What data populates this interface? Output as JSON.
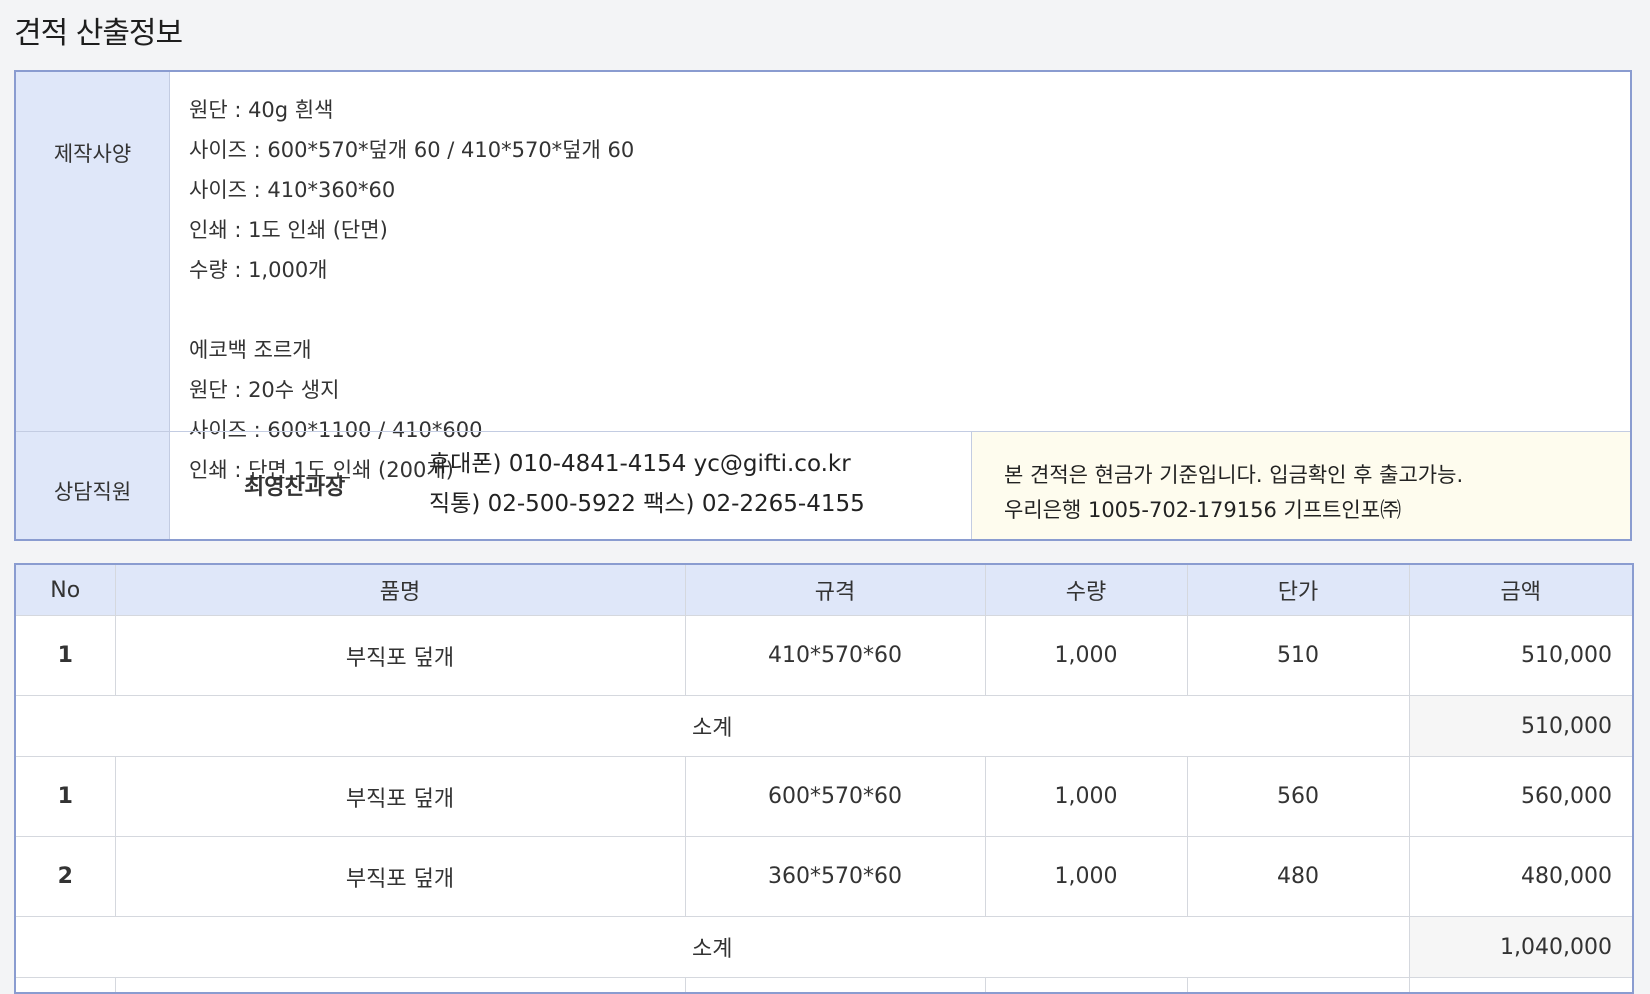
{
  "page": {
    "title": "견적 산출정보"
  },
  "info": {
    "spec_label": "제작사양",
    "spec_lines": [
      "원단 : 40g 흰색",
      "사이즈 : 600*570*덮개 60 / 410*570*덮개 60",
      "사이즈 : 410*360*60",
      "인쇄 : 1도 인쇄 (단면)",
      "수량 : 1,000개",
      "",
      "에코백 조르개",
      "원단 : 20수 생지",
      "사이즈 : 600*1100 / 410*600",
      "인쇄 : 단면 1도 인쇄 (200개)"
    ],
    "staff_label": "상담직원",
    "staff_name": "최영찬과장",
    "phone_line": "휴대폰) 010-4841-4154  yc@gifti.co.kr",
    "direct_line": "직통) 02-500-5922 팩스) 02-2265-4155",
    "notice_line1": "본 견적은 현금가 기준입니다. 입금확인 후 출고가능.",
    "notice_line2": "우리은행 1005-702-179156 기프트인포㈜"
  },
  "table": {
    "headers": [
      "No",
      "품명",
      "규격",
      "수량",
      "단가",
      "금액"
    ],
    "rows": [
      {
        "no": "1",
        "name": "부직포 덮개",
        "spec": "410*570*60",
        "qty": "1,000",
        "unit": "510",
        "amount": "510,000"
      },
      {
        "subtotal_label": "소계",
        "amount": "510,000"
      },
      {
        "no": "1",
        "name": "부직포 덮개",
        "spec": "600*570*60",
        "qty": "1,000",
        "unit": "560",
        "amount": "560,000"
      },
      {
        "no": "2",
        "name": "부직포 덮개",
        "spec": "360*570*60",
        "qty": "1,000",
        "unit": "480",
        "amount": "480,000"
      },
      {
        "subtotal_label": "소계",
        "amount": "1,040,000"
      }
    ]
  }
}
